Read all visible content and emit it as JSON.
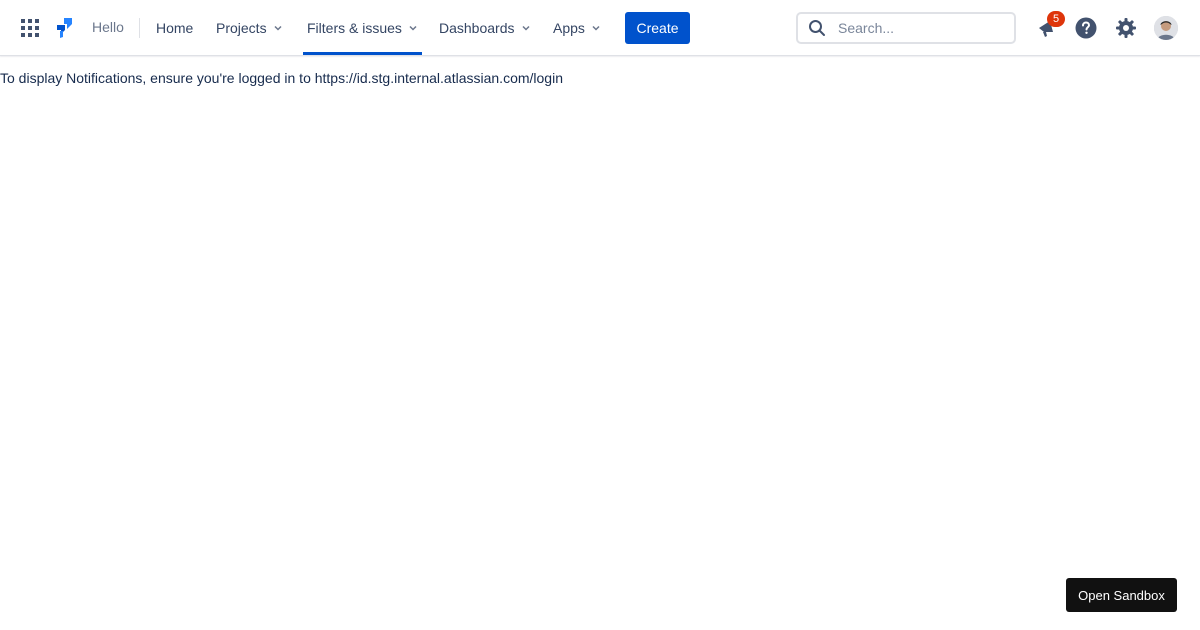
{
  "header": {
    "app_switcher_icon": "grid-icon",
    "logo_icon": "jira-logo-icon",
    "greeting": "Hello",
    "nav": [
      {
        "label": "Home",
        "has_dropdown": false,
        "active": false
      },
      {
        "label": "Projects",
        "has_dropdown": true,
        "active": false
      },
      {
        "label": "Filters & issues",
        "has_dropdown": true,
        "active": true
      },
      {
        "label": "Dashboards",
        "has_dropdown": true,
        "active": false
      },
      {
        "label": "Apps",
        "has_dropdown": true,
        "active": false
      }
    ],
    "create_label": "Create",
    "search": {
      "placeholder": "Search...",
      "value": ""
    },
    "notifications": {
      "icon": "megaphone-icon",
      "count": "5"
    },
    "help_icon": "help-icon",
    "settings_icon": "gear-icon",
    "avatar_icon": "avatar"
  },
  "main": {
    "message": "To display Notifications, ensure you're logged in to https://id.stg.internal.atlassian.com/login"
  },
  "footer": {
    "sandbox_label": "Open Sandbox"
  },
  "colors": {
    "accent": "#0052cc",
    "badge": "#de350b",
    "text": "#172b4d",
    "muted": "#6b778c"
  }
}
